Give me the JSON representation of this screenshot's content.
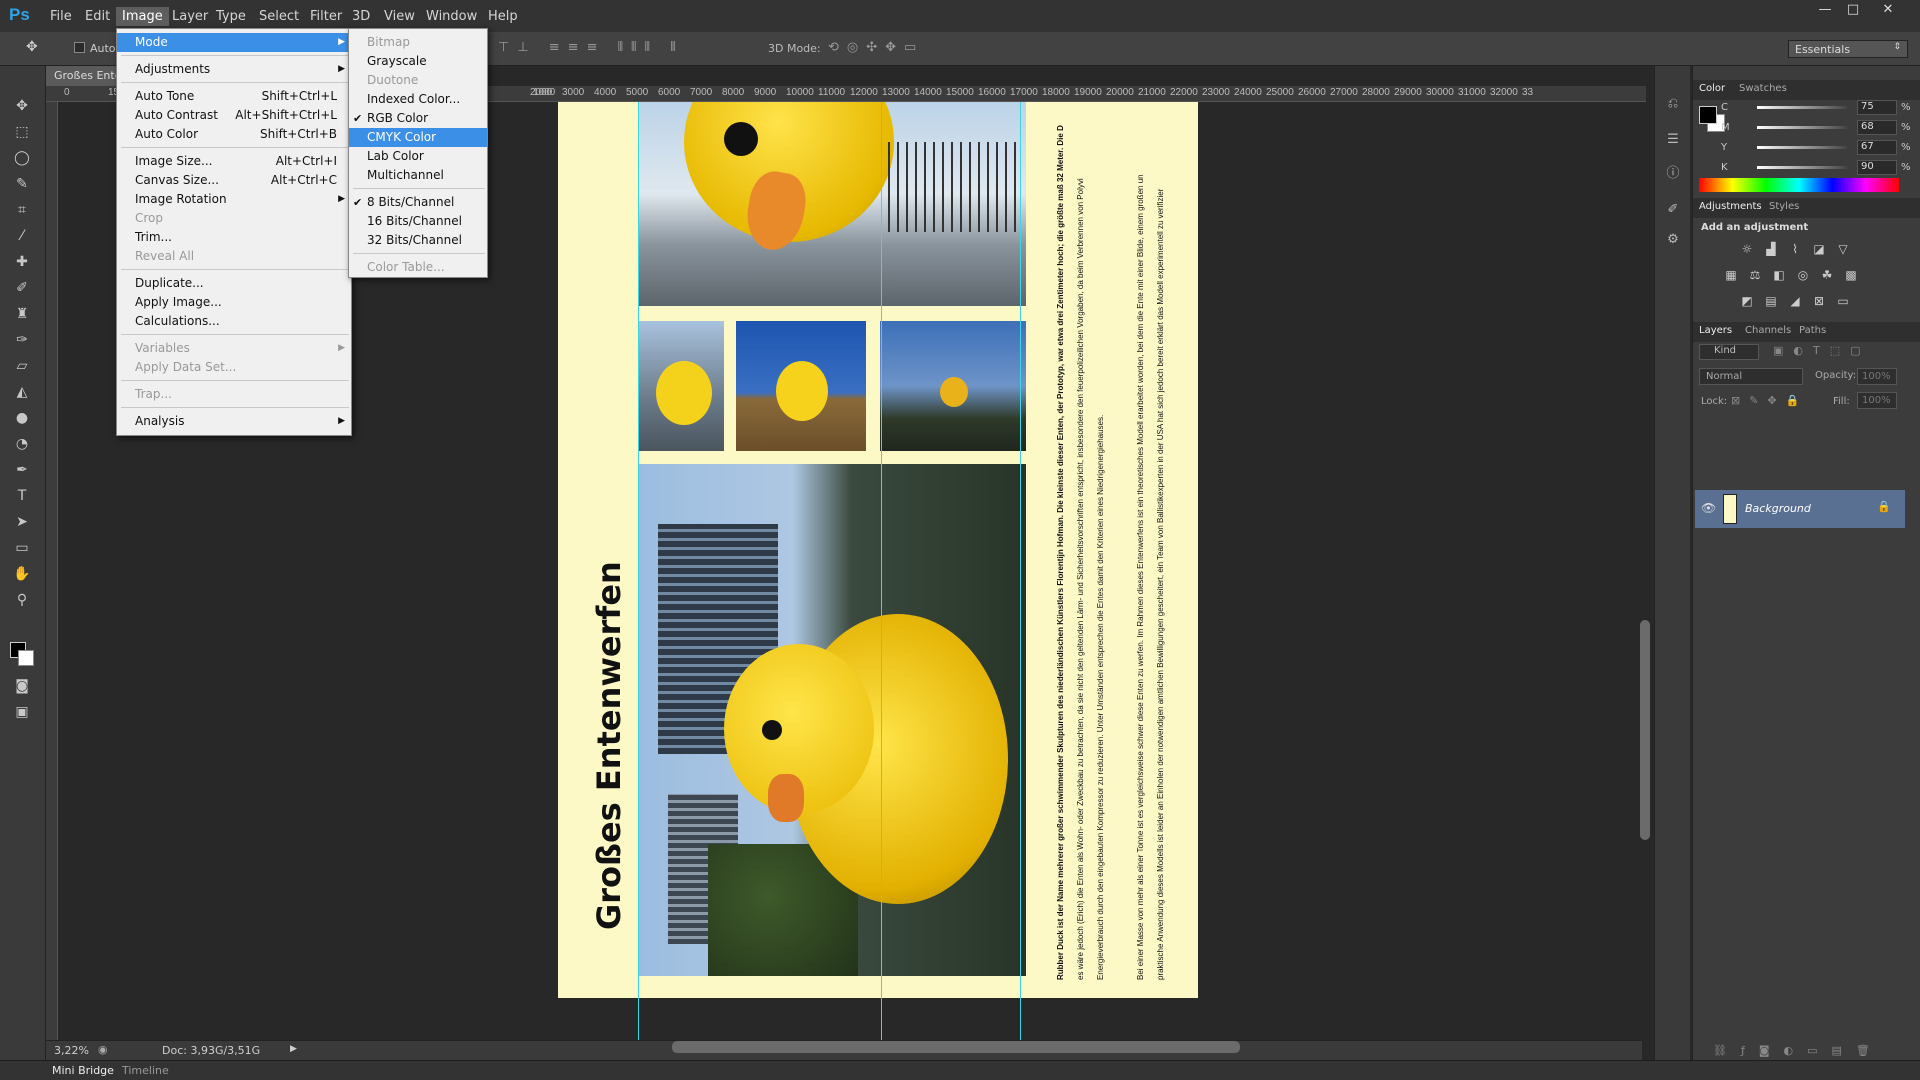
{
  "app": {
    "logo": "Ps"
  },
  "menubar": [
    "File",
    "Edit",
    "Image",
    "Layer",
    "Type",
    "Select",
    "Filter",
    "3D",
    "View",
    "Window",
    "Help"
  ],
  "window_controls": [
    "—",
    "□",
    "✕"
  ],
  "options": {
    "auto_label": "Auto-",
    "mode3d_label": "3D Mode:",
    "workspace": "Essentials"
  },
  "document": {
    "tab_title": "Großes Ente",
    "zoom": "3,22%",
    "doc_info": "Doc: 3,93G/3,51G",
    "title": "Großes Entenwerfen",
    "text1": "Rubber Duck ist der Name mehrerer großer schwimmender Skulpturen des niederländischen Künstlers Florentijn Hofman. Die kleinste dieser Enten, der Prototyp, war etwa drei Zentimeter hoch; die größte maß 32 Meter. Die D",
    "text2": "es wäre jedoch (Erich) die Enten als Wohn- oder Zweckbau zu betrachten, da sie nicht den geltenden Lärm- und Sicherheitsvorschriften entspricht, insbesondere den feuerpolizeilichen Vorgaben, da beim Verbrennen von Polyvi",
    "text3": "Energieverbrauch durch den eingebauten Kompressor zu reduzieren. Unter Umständen entsprechen die Entes damit den Kriterien eines Niedrigenergiehauses.",
    "text4": "Bei einer Masse von mehr als einer Tonne ist es vergleichsweise schwer diese Enten zu werfen. Im Rahmen dieses Entenwerfens ist ein theoretisches Modell erarbeitet worden, bei dem die Ente mit einer Blide, einem großen un",
    "text5": "praktische Anwendung dieses Modells ist leider an Einholen der notwendigen amtlichen Bewilligungen gescheitert, ein Team von Ballistikexperten in der USA hat sich jedoch bereit erklärt das Modell experimentell zu verifizier"
  },
  "ruler_ticks": [
    "0",
    "15000",
    "14000",
    "1000",
    "2000",
    "3000",
    "4000",
    "5000",
    "6000",
    "7000",
    "8000",
    "9000",
    "10000",
    "11000",
    "12000",
    "13000",
    "14000",
    "15000",
    "16000",
    "17000",
    "18000",
    "19000",
    "20000",
    "21000",
    "22000",
    "23000",
    "24000",
    "25000",
    "26000",
    "27000",
    "28000",
    "29000",
    "30000",
    "31000",
    "32000",
    "33"
  ],
  "image_menu": {
    "items": [
      {
        "label": "Mode",
        "submenu": true,
        "highlight": true
      },
      {
        "sep": true
      },
      {
        "label": "Adjustments",
        "submenu": true
      },
      {
        "sep": true
      },
      {
        "label": "Auto Tone",
        "shortcut": "Shift+Ctrl+L"
      },
      {
        "label": "Auto Contrast",
        "shortcut": "Alt+Shift+Ctrl+L"
      },
      {
        "label": "Auto Color",
        "shortcut": "Shift+Ctrl+B"
      },
      {
        "sep": true
      },
      {
        "label": "Image Size...",
        "shortcut": "Alt+Ctrl+I"
      },
      {
        "label": "Canvas Size...",
        "shortcut": "Alt+Ctrl+C"
      },
      {
        "label": "Image Rotation",
        "submenu": true
      },
      {
        "label": "Crop",
        "disabled": true
      },
      {
        "label": "Trim..."
      },
      {
        "label": "Reveal All",
        "disabled": true
      },
      {
        "sep": true
      },
      {
        "label": "Duplicate..."
      },
      {
        "label": "Apply Image..."
      },
      {
        "label": "Calculations..."
      },
      {
        "sep": true
      },
      {
        "label": "Variables",
        "submenu": true,
        "disabled": true
      },
      {
        "label": "Apply Data Set...",
        "disabled": true
      },
      {
        "sep": true
      },
      {
        "label": "Trap...",
        "disabled": true
      },
      {
        "sep": true
      },
      {
        "label": "Analysis",
        "submenu": true
      }
    ]
  },
  "mode_menu": {
    "items": [
      {
        "label": "Bitmap",
        "disabled": true
      },
      {
        "label": "Grayscale"
      },
      {
        "label": "Duotone",
        "disabled": true
      },
      {
        "label": "Indexed Color..."
      },
      {
        "label": "RGB Color",
        "checked": true
      },
      {
        "label": "CMYK Color",
        "highlight": true
      },
      {
        "label": "Lab Color"
      },
      {
        "label": "Multichannel"
      },
      {
        "sep": true
      },
      {
        "label": "8 Bits/Channel",
        "checked": true
      },
      {
        "label": "16 Bits/Channel"
      },
      {
        "label": "32 Bits/Channel"
      },
      {
        "sep": true
      },
      {
        "label": "Color Table...",
        "disabled": true
      }
    ]
  },
  "check_glyph": "✔",
  "arrow_glyph": "▶",
  "panels": {
    "color_tabs": [
      "Color",
      "Swatches"
    ],
    "cmyk": [
      {
        "label": "C",
        "value": "75",
        "pct": "%"
      },
      {
        "label": "M",
        "value": "68",
        "pct": "%"
      },
      {
        "label": "Y",
        "value": "67",
        "pct": "%"
      },
      {
        "label": "K",
        "value": "90",
        "pct": "%"
      }
    ],
    "adj_tabs": [
      "Adjustments",
      "Styles"
    ],
    "add_adjustment": "Add an adjustment",
    "layers_tabs": [
      "Layers",
      "Channels",
      "Paths"
    ],
    "kind": "Kind",
    "blend_mode": "Normal",
    "opacity_label": "Opacity:",
    "opacity": "100%",
    "lock_label": "Lock:",
    "fill_label": "Fill:",
    "fill": "100%",
    "layer_name": "Background"
  },
  "bottom_tabs": [
    "Mini Bridge",
    "Timeline"
  ],
  "colors": {
    "highlight": "#3b8fe6",
    "doc_bg": "#fdf9c7",
    "guide": "#3ad6e6",
    "layer_sel": "#597093"
  }
}
